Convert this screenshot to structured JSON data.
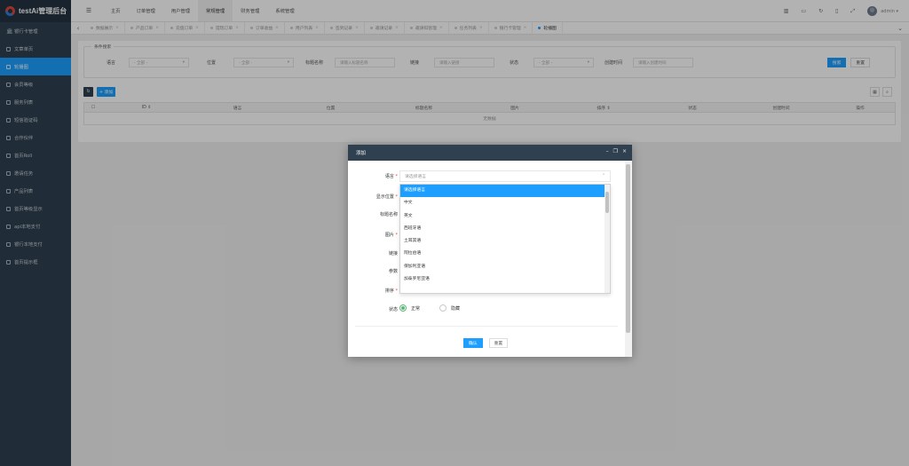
{
  "brand": {
    "title": "testAi管理后台"
  },
  "sidebar": {
    "items": [
      {
        "label": "银行卡管理"
      },
      {
        "label": "文章单页"
      },
      {
        "label": "轮播图"
      },
      {
        "label": "会员等级"
      },
      {
        "label": "服务列表"
      },
      {
        "label": "短信验证码"
      },
      {
        "label": "合作伙伴"
      },
      {
        "label": "首页Roll"
      },
      {
        "label": "邀请任务"
      },
      {
        "label": "产品列表"
      },
      {
        "label": "首页等级显示"
      },
      {
        "label": "api本地支付"
      },
      {
        "label": "银行本地支付"
      },
      {
        "label": "首页提示框"
      }
    ]
  },
  "topnav": {
    "items": [
      {
        "label": "主页"
      },
      {
        "label": "订单管理"
      },
      {
        "label": "用户管理"
      },
      {
        "label": "常规管理"
      },
      {
        "label": "财务管理"
      },
      {
        "label": "系统管理"
      }
    ],
    "user": "admin ▾"
  },
  "tabs": [
    {
      "label": "数据展示"
    },
    {
      "label": "产品订单"
    },
    {
      "label": "充值订单"
    },
    {
      "label": "提现订单"
    },
    {
      "label": "订单收益"
    },
    {
      "label": "用户列表"
    },
    {
      "label": "签到记录"
    },
    {
      "label": "邀请记录"
    },
    {
      "label": "邀请码管理"
    },
    {
      "label": "任务列表"
    },
    {
      "label": "银行卡管理"
    },
    {
      "label": "轮播图"
    }
  ],
  "filter": {
    "legend": "条件搜索",
    "fields": [
      {
        "label": "语言",
        "value": "- 全部 -"
      },
      {
        "label": "位置",
        "value": "- 全部 -"
      },
      {
        "label": "标题名称",
        "value": "请输入标题名称"
      },
      {
        "label": "链接",
        "value": "请输入链接"
      },
      {
        "label": "状态",
        "value": "- 全部 -"
      },
      {
        "label": "创建时间",
        "value": "请输入创建时间"
      }
    ],
    "search_label": "搜索",
    "reset_label": "重置"
  },
  "toolbar": {
    "add_label": "+ 添加"
  },
  "table": {
    "columns": [
      "ID ⇕",
      "语言",
      "位置",
      "标题名称",
      "图片",
      "排序 ⇕",
      "状态",
      "创建时间",
      "操作"
    ],
    "empty_text": "无数据"
  },
  "modal": {
    "title": "添加",
    "fields": {
      "language_label": "语言",
      "position_label": "显示位置",
      "title_label": "标题名称",
      "image_label": "图片",
      "link_label": "链接",
      "param_label": "参数",
      "sort_label": "排序",
      "status_label": "状态"
    },
    "language_placeholder": "请选择语言",
    "dropdown_options": [
      {
        "label": "请选择语言"
      },
      {
        "label": "中文"
      },
      {
        "label": "英文"
      },
      {
        "label": "西班牙语"
      },
      {
        "label": "土耳其语"
      },
      {
        "label": "阿拉伯语"
      },
      {
        "label": "保加利亚语"
      },
      {
        "label": "加泰罗尼亚语"
      }
    ],
    "status_options": [
      {
        "label": "正常",
        "checked": true
      },
      {
        "label": "隐藏",
        "checked": false
      }
    ],
    "confirm_label": "确认",
    "reset_label": "重置"
  },
  "colors": {
    "primary": "#1e9fff",
    "sidebar": "#2f4050",
    "success": "#5fb878"
  }
}
